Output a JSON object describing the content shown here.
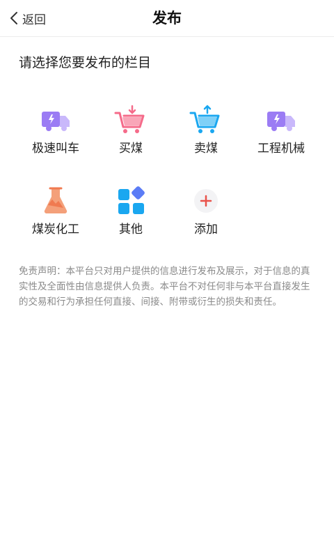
{
  "header": {
    "back_label": "返回",
    "title": "发布"
  },
  "prompt": "请选择您要发布的栏目",
  "categories": [
    {
      "label": "极速叫车",
      "icon": "truck-icon"
    },
    {
      "label": "买煤",
      "icon": "cart-down-icon"
    },
    {
      "label": "卖煤",
      "icon": "cart-up-icon"
    },
    {
      "label": "工程机械",
      "icon": "truck-icon"
    },
    {
      "label": "煤炭化工",
      "icon": "flask-icon"
    },
    {
      "label": "其他",
      "icon": "apps-icon"
    },
    {
      "label": "添加",
      "icon": "plus-icon"
    }
  ],
  "disclaimer": "免责声明：本平台只对用户提供的信息进行发布及展示，对于信息的真实性及全面性由信息提供人负责。本平台不对任何非与本平台直接发生的交易和行为承担任何直接、间接、附带或衍生的损失和责任。",
  "colors": {
    "purple": "#9b7cf4",
    "pink": "#f56b8a",
    "blue": "#1aa7f0",
    "orange": "#f07a50",
    "red": "#e9524a"
  }
}
